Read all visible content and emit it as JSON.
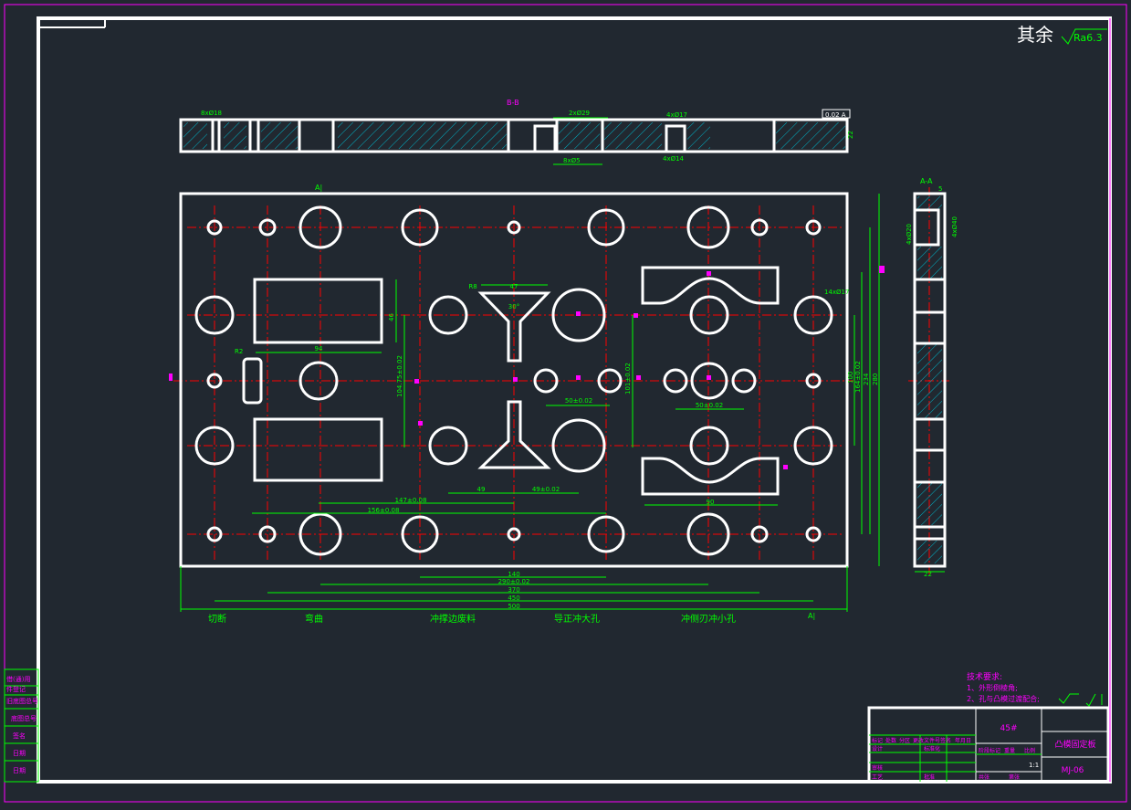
{
  "roughness": {
    "prefix": "其余",
    "value": "Ra6.3"
  },
  "section_labels": {
    "bb": "B-B",
    "aa_top": "A|",
    "aa_bottom": "A|",
    "aa_side": "A-A"
  },
  "station_labels": [
    "切断",
    "弯曲",
    "冲撑边废料",
    "导正冲大孔",
    "冲侧刃冲小孔"
  ],
  "tech_req": {
    "title": "技术要求:",
    "items": [
      "1、外形倒棱角;",
      "2、孔与凸模过渡配合;"
    ]
  },
  "dimensions": {
    "horizontal": [
      "140",
      "290±0.02",
      "370",
      "450",
      "500",
      "147±0.08",
      "156±0.08",
      "49",
      "49±0.02",
      "50±0.02",
      "50±0.02",
      "94",
      "90",
      "47",
      "R8",
      "30°"
    ],
    "vertical": [
      "100",
      "164±0.02",
      "234",
      "280",
      "104.75±0.02",
      "101±0.02",
      "46",
      "R2",
      "14xØ17"
    ],
    "top_view": [
      "8xØ18",
      "2xØ29",
      "4xØ17",
      "8xØ5",
      "4xØ14",
      "22"
    ],
    "side_view": [
      "4xØ20",
      "4xØ40",
      "22",
      "5"
    ],
    "tolerance_box": "0.02 A"
  },
  "title_block": {
    "material": "45#",
    "part_name": "凸模固定板",
    "drawing_no": "MJ-06",
    "scale": "1:1",
    "row_labels": [
      "标记",
      "处数",
      "分区",
      "更改文件号",
      "签名",
      "年月日"
    ],
    "cells": [
      "设计",
      "标准化",
      "审核",
      "工艺",
      "批准",
      "阶段标记",
      "重量",
      "比例",
      "共张",
      "第张"
    ]
  },
  "left_stamp": [
    "借(通)用",
    "件登记",
    "旧底图总号",
    "底图总号",
    "签名",
    "日期",
    "日期"
  ],
  "colors": {
    "background": "#212830",
    "outline": "#FFFFFF",
    "dimension": "#00FF00",
    "centerline": "#FF0000",
    "frame": "#FF00FF",
    "hatch": "#00B4C8"
  }
}
